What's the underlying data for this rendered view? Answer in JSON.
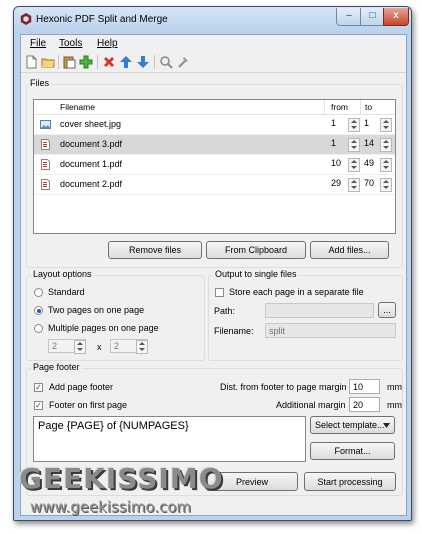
{
  "window": {
    "title": "Hexonic PDF Split and Merge",
    "controls": [
      "–",
      "□",
      "x"
    ]
  },
  "menu": [
    "File",
    "Tools",
    "Help"
  ],
  "toolbar_icons": [
    "new-document-icon",
    "open-folder-icon",
    "paste-icon",
    "add-icon",
    "remove-icon",
    "move-up-icon",
    "move-down-icon",
    "search-icon",
    "tools-icon"
  ],
  "files": {
    "group_label": "Files",
    "columns": {
      "filename": "Filename",
      "from": "from",
      "to": "to"
    },
    "rows": [
      {
        "name": "cover sheet.jpg",
        "type": "image",
        "from": "1",
        "to": "1",
        "selected": false
      },
      {
        "name": "document 3.pdf",
        "type": "pdf",
        "from": "1",
        "to": "14",
        "selected": true
      },
      {
        "name": "document 1.pdf",
        "type": "pdf",
        "from": "10",
        "to": "49",
        "selected": false
      },
      {
        "name": "document 2.pdf",
        "type": "pdf",
        "from": "29",
        "to": "70",
        "selected": false
      }
    ],
    "buttons": {
      "remove": "Remove files",
      "clipboard": "From Clipboard",
      "add": "Add files..."
    }
  },
  "layout": {
    "group_label": "Layout options",
    "options": [
      "Standard",
      "Two pages on one page",
      "Multiple pages on one page"
    ],
    "selected_index": 1,
    "cols": "2",
    "x_label": "x",
    "rows": "2"
  },
  "output": {
    "group_label": "Output to single files",
    "store_label": "Store each page in a separate file",
    "store_checked": false,
    "path_label": "Path:",
    "path_value": "",
    "browse": "...",
    "filename_label": "Filename:",
    "filename_value": "split"
  },
  "footer": {
    "group_label": "Page footer",
    "add_label": "Add page footer",
    "add_checked": true,
    "first_label": "Footer on first page",
    "first_checked": true,
    "dist_label": "Dist. from footer to page margin",
    "dist_value": "10",
    "dist_unit": "mm",
    "additional_label": "Additional margin",
    "additional_value": "20",
    "additional_unit": "mm",
    "template_text": "Page {PAGE} of {NUMPAGES}",
    "select_template": "Select template...",
    "format": "Format..."
  },
  "actions": {
    "preview": "Preview",
    "start": "Start processing"
  },
  "watermark": {
    "brand": "GEEKISSIMO",
    "url": "www.geekissimo.com"
  },
  "colors": {
    "titlebar": "#bcd2ea",
    "selection": "#d8d8d8",
    "pdf_icon": "#c8302a",
    "accent_arrow": "#2f7ed8",
    "delete": "#d8322a"
  }
}
